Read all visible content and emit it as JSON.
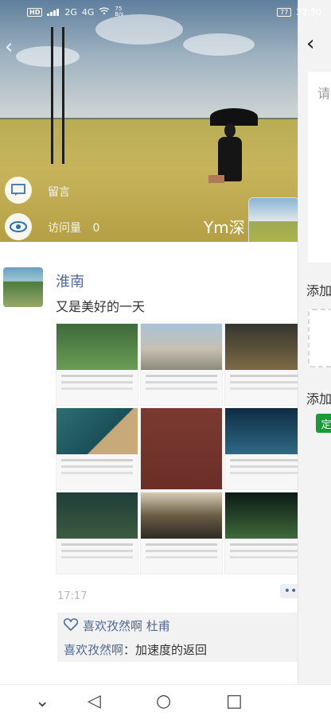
{
  "status_bar": {
    "left_badge": "HD",
    "net1": "2G",
    "net2": "4G",
    "speed": "75\nB/s",
    "time": "22:30",
    "battery": "77"
  },
  "cover": {
    "comment_label": "留言",
    "visits_label": "访问量",
    "visits_count": "0",
    "user_name": "Ym深"
  },
  "post": {
    "author": "淮南",
    "content": "又是美好的一天",
    "time": "17:17",
    "likes_heart_icon": "heart-icon",
    "likes_names": "喜欢孜然啊 杜甫",
    "comment_author": "喜欢孜然啊",
    "comment_sep": "：",
    "comment_text": "加速度的返回"
  },
  "side_panel": {
    "back_arrow": "‹",
    "placeholder": "请",
    "add_image_label": "添加",
    "add_tag_label": "添加",
    "tag": "定"
  },
  "navbar": {
    "down": "⌄",
    "back": "◁",
    "home": "○",
    "recent": "□"
  }
}
